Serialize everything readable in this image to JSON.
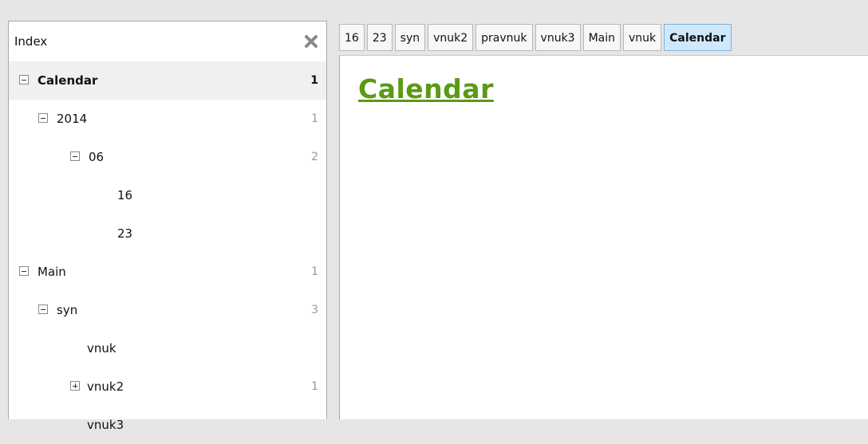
{
  "index": {
    "title": "Index",
    "close_icon": "close-icon",
    "rows": [
      {
        "label": "Calendar",
        "count": "1",
        "expander": "minus",
        "bold": true
      },
      {
        "label": "2014",
        "count": "1",
        "expander": "minus"
      },
      {
        "label": "06",
        "count": "2",
        "expander": "minus"
      },
      {
        "label": "16",
        "count": "",
        "expander": "none"
      },
      {
        "label": "23",
        "count": "",
        "expander": "none"
      },
      {
        "label": "Main",
        "count": "1",
        "expander": "minus"
      },
      {
        "label": "syn",
        "count": "3",
        "expander": "minus"
      },
      {
        "label": "vnuk",
        "count": "",
        "expander": "none"
      },
      {
        "label": "vnuk2",
        "count": "1",
        "expander": "plus"
      },
      {
        "label": "vnuk3",
        "count": "",
        "expander": "none"
      }
    ]
  },
  "tabs": [
    {
      "label": "16"
    },
    {
      "label": "23"
    },
    {
      "label": "syn"
    },
    {
      "label": "vnuk2"
    },
    {
      "label": "pravnuk"
    },
    {
      "label": "vnuk3"
    },
    {
      "label": "Main"
    },
    {
      "label": "vnuk"
    },
    {
      "label": "Calendar",
      "active": true
    }
  ],
  "page": {
    "title": "Calendar",
    "title_color": "#5a9a14"
  },
  "colors": {
    "selected_row_bg": "#f0f0f0",
    "active_tab_bg": "#cfe8fb"
  }
}
